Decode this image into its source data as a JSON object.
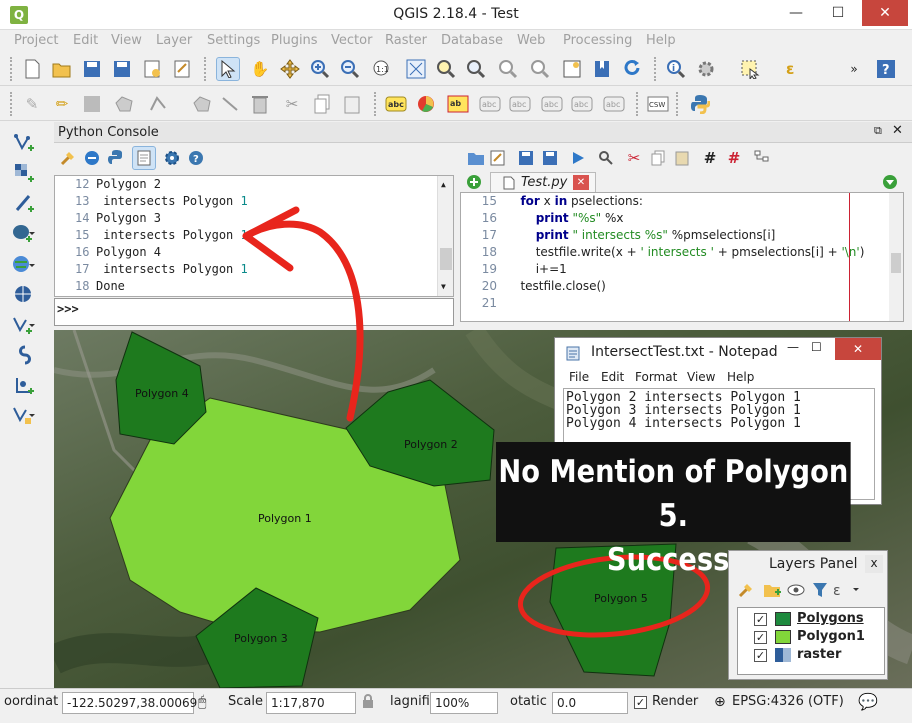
{
  "window": {
    "title": "QGIS 2.18.4 - Test",
    "app_icon": "Q",
    "minimize": "—",
    "maximize": "☐",
    "close": "✕"
  },
  "menu": [
    "Project",
    "Edit",
    "View",
    "Layer",
    "Settings",
    "Plugins",
    "Vector",
    "Raster",
    "Database",
    "Web",
    "Processing",
    "Help"
  ],
  "python_console": {
    "title": "Python Console",
    "output_lines": [
      {
        "n": "12",
        "text": "Polygon 2",
        "num": ""
      },
      {
        "n": "13",
        "text": " intersects Polygon ",
        "num": "1"
      },
      {
        "n": "14",
        "text": "Polygon 3",
        "num": ""
      },
      {
        "n": "15",
        "text": " intersects Polygon ",
        "num": "1"
      },
      {
        "n": "16",
        "text": "Polygon 4",
        "num": ""
      },
      {
        "n": "17",
        "text": " intersects Polygon ",
        "num": "1"
      },
      {
        "n": "18",
        "text": "Done",
        "num": ""
      }
    ],
    "prompt": ">>>"
  },
  "editor": {
    "tab_label": "Test.py",
    "lines": [
      {
        "n": "15",
        "html": "<span class='kw'>for</span> x <span class='kw'>in</span> pselections:",
        "indent": "   "
      },
      {
        "n": "16",
        "html": "<span class='kw'>print</span> <span class='str'>\"%s\"</span> %x",
        "indent": "       "
      },
      {
        "n": "17",
        "html": "<span class='kw'>print</span> <span class='str'>\" intersects %s\"</span> %pmselections[i]",
        "indent": "       "
      },
      {
        "n": "18",
        "html": "testfile.write(x + <span class='str'>' intersects '</span> + pmselections[i] + <span class='str'>'\\n'</span>)",
        "indent": "       "
      },
      {
        "n": "19",
        "html": "i+=1",
        "indent": "       "
      },
      {
        "n": "20",
        "html": "testfile.close()",
        "indent": "   "
      },
      {
        "n": "21",
        "html": "",
        "indent": ""
      }
    ]
  },
  "notepad": {
    "title": "IntersectTest.txt - Notepad",
    "menu": [
      "File",
      "Edit",
      "Format",
      "View",
      "Help"
    ],
    "lines": [
      "Polygon 2 intersects Polygon 1",
      "Polygon 3 intersects Polygon 1",
      "Polygon 4 intersects Polygon 1"
    ]
  },
  "callout": {
    "line1": "No Mention of Polygon 5.",
    "line2": "Success."
  },
  "map": {
    "polygons": [
      {
        "label": "Polygon 1",
        "color": "#82d63a"
      },
      {
        "label": "Polygon 2",
        "color": "#1e7a1e"
      },
      {
        "label": "Polygon 3",
        "color": "#1e7a1e"
      },
      {
        "label": "Polygon 4",
        "color": "#1e7a1e"
      },
      {
        "label": "Polygon 5",
        "color": "#1e7a1e"
      }
    ],
    "annotation_color": "#e8251c"
  },
  "layers_panel": {
    "title": "Layers Panel",
    "close": "x",
    "layers": [
      {
        "name": "Polygons",
        "swatch": "#1e8a3e",
        "checked": "✓",
        "underline": true
      },
      {
        "name": "Polygon1",
        "swatch": "#82d63a",
        "checked": "✓",
        "underline": false
      },
      {
        "name": "raster",
        "swatch": "raster",
        "checked": "✓",
        "underline": false
      }
    ]
  },
  "status": {
    "coord_label": "oordinat",
    "coord_value": "-122.50297,38.00069",
    "scale_label": "Scale",
    "scale_value": "1:17,870",
    "magnifier_label": "lagnifie",
    "magnifier_value": "100%",
    "rotation_label": "otatic",
    "rotation_value": "0.0",
    "render_label": "Render",
    "render_checked": "✓",
    "crs": "EPSG:4326 (OTF)"
  }
}
